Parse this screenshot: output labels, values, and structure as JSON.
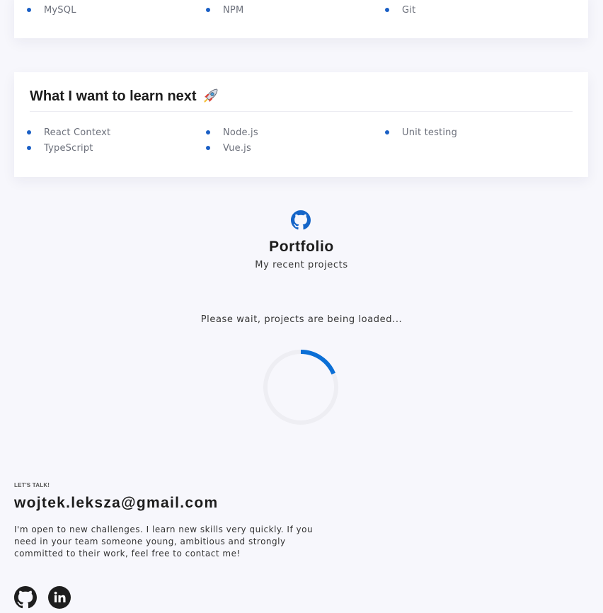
{
  "skills_top": [
    "MySQL",
    "NPM",
    "Git"
  ],
  "learn_next": {
    "title": "What I want to learn next",
    "items": [
      "React Context",
      "Node.js",
      "Unit testing",
      "TypeScript",
      "Vue.js"
    ]
  },
  "portfolio": {
    "icon": "github-icon",
    "title": "Portfolio",
    "subtitle": "My recent projects",
    "loading_text": "Please wait, projects are being loaded..."
  },
  "contact": {
    "kicker": "LET'S TALK!",
    "email": "wojtek.leksza@gmail.com",
    "message": "I'm open to new challenges. I learn new skills very quickly. If you need in your team someone young, ambitious and strongly committed to their work, feel free to contact me!",
    "socials": [
      "github-icon",
      "linkedin-icon"
    ]
  },
  "colors": {
    "accent": "#1a5fc5",
    "spinner_active": "#0b6fd6",
    "spinner_track": "#eeeef3",
    "background": "#f7f7fc"
  }
}
